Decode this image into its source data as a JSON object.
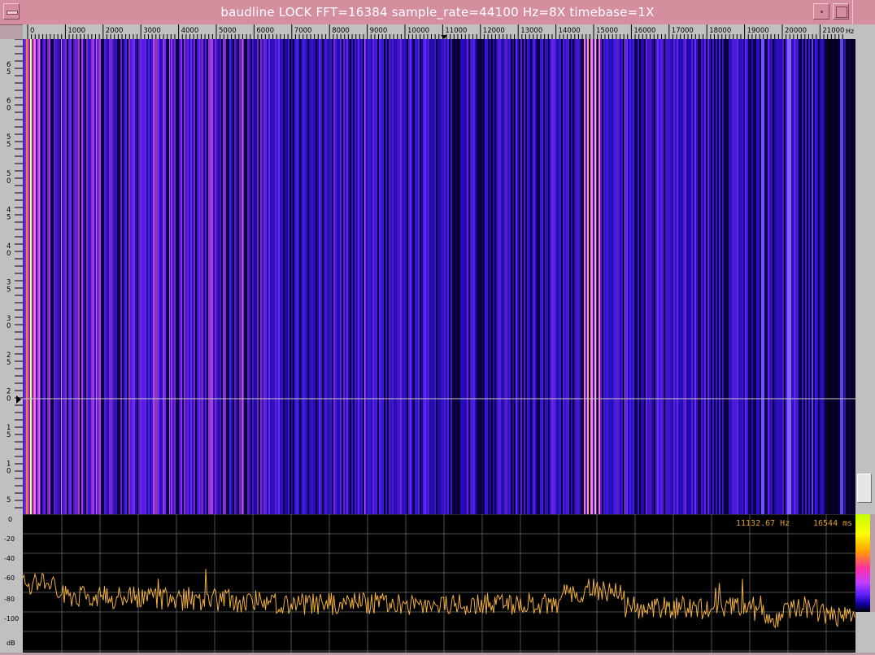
{
  "window": {
    "title": "baudline  LOCK FFT=16384 sample_rate=44100 Hz=8X timebase=1X"
  },
  "freq_axis": {
    "unit": "Hz",
    "ticks": [
      "0",
      "1000",
      "2000",
      "3000",
      "4000",
      "5000",
      "6000",
      "7000",
      "8000",
      "9000",
      "10000",
      "11000",
      "12000",
      "13000",
      "14000",
      "15000",
      "16000",
      "17000",
      "18000",
      "19000",
      "20000",
      "21000"
    ]
  },
  "time_axis": {
    "ticks": [
      "65",
      "60",
      "55",
      "50",
      "45",
      "40",
      "35",
      "30",
      "25",
      "20",
      "15",
      "10",
      "5"
    ]
  },
  "db_axis": {
    "ticks": [
      "0",
      "-20",
      "-40",
      "-60",
      "-80",
      "-100"
    ],
    "unit": "dB"
  },
  "readout": {
    "frequency": "11132.67 Hz",
    "time": "16544 ms"
  },
  "colors": {
    "spectrogram_bg": "#140070",
    "trace": "#f0b040",
    "cursor_line": "#c8c8c8"
  }
}
